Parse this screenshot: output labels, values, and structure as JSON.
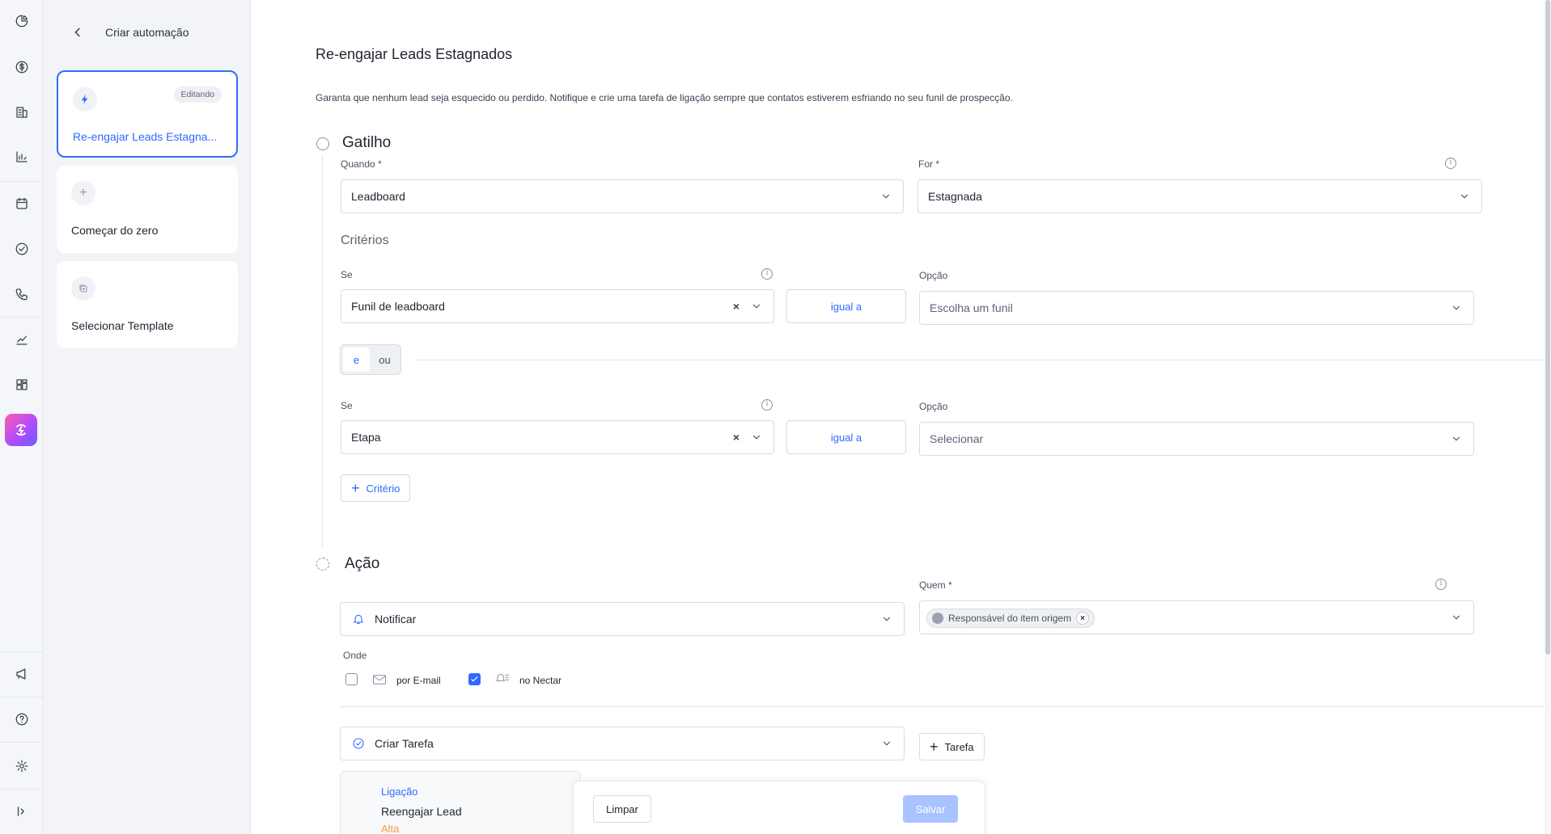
{
  "rail": {
    "icons": [
      "pie-chart-icon",
      "dollar-icon",
      "building-icon",
      "bar-chart-icon",
      "calendar-icon",
      "check-circle-icon",
      "phone-icon",
      "trend-icon",
      "widgets-icon",
      "automation-icon",
      "announcement-icon",
      "help-icon",
      "settings-icon",
      "collapse-icon"
    ],
    "active_gradient": [
      "#ff5da8",
      "#b14cff",
      "#6a5cff"
    ]
  },
  "sidebar": {
    "title": "Criar automação",
    "cards": [
      {
        "label": "Re-engajar Leads Estagna...",
        "badge": "Editando",
        "icon": "lightning-icon"
      },
      {
        "label": "Começar do zero",
        "icon": "plus-icon"
      },
      {
        "label": "Selecionar Template",
        "icon": "template-icon"
      }
    ]
  },
  "main": {
    "title": "Re-engajar Leads Estagnados",
    "description": "Garanta que nenhum lead seja esquecido ou perdido. Notifique e crie uma tarefa de ligação sempre que contatos estiverem esfriando no seu funil de prospecção.",
    "trigger": {
      "title": "Gatilho",
      "when_label": "Quando *",
      "when_value": "Leadboard",
      "for_label": "For *",
      "for_value": "Estagnada"
    },
    "criteria": {
      "title": "Critérios",
      "rows": [
        {
          "if_label": "Se",
          "field": "Funil de leadboard",
          "operator": "igual a",
          "option_label": "Opção",
          "option_placeholder": "Escolha um funil"
        },
        {
          "if_label": "Se",
          "field": "Etapa",
          "operator": "igual a",
          "option_label": "Opção",
          "option_placeholder": "Selecionar"
        }
      ],
      "join": {
        "and": "e",
        "or": "ou",
        "selected": "e"
      },
      "add_button": "Critério"
    },
    "action": {
      "title": "Ação",
      "notify": "Notificar",
      "who_label": "Quem *",
      "who_chip": "Responsável do item origem",
      "where_label": "Onde",
      "email_option": "por E-mail",
      "email_checked": false,
      "nectar_option": "no Nectar",
      "nectar_checked": true,
      "create_task": "Criar Tarefa",
      "task_button": "Tarefa",
      "task_card": {
        "type": "Ligação",
        "title": "Reengajar Lead",
        "priority": "Alta"
      }
    },
    "footer": {
      "clear": "Limpar",
      "save": "Salvar"
    }
  },
  "colors": {
    "accent": "#2f6bff",
    "priority_high": "#f39b4a",
    "save_disabled": "#a8c3ff"
  }
}
